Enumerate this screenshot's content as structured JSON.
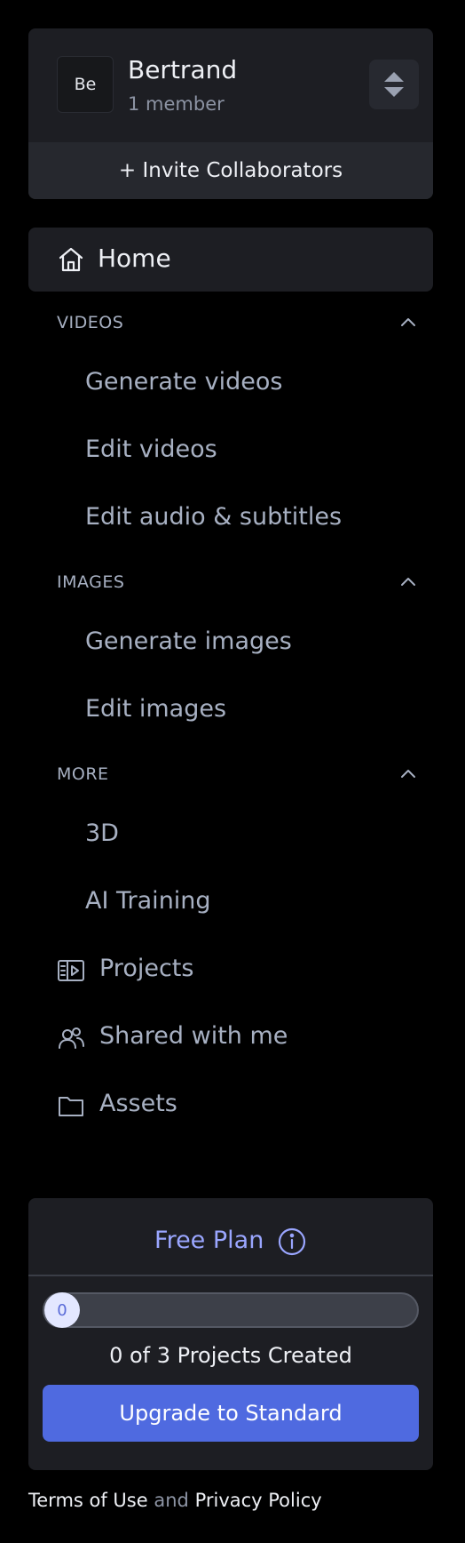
{
  "team": {
    "avatar_initials": "Be",
    "name": "Bertrand",
    "members": "1 member",
    "invite_label": "+ Invite Collaborators"
  },
  "nav": {
    "home_label": "Home",
    "sections": [
      {
        "title": "VIDEOS",
        "expanded": true,
        "items": [
          "Generate videos",
          "Edit videos",
          "Edit audio & subtitles"
        ]
      },
      {
        "title": "IMAGES",
        "expanded": true,
        "items": [
          "Generate images",
          "Edit images"
        ]
      },
      {
        "title": "MORE",
        "expanded": true,
        "items": [
          "3D",
          "AI Training"
        ]
      }
    ],
    "bottom_items": [
      {
        "label": "Projects",
        "icon": "projects-icon"
      },
      {
        "label": "Shared with me",
        "icon": "shared-users-icon"
      },
      {
        "label": "Assets",
        "icon": "folder-icon"
      }
    ]
  },
  "plan": {
    "title": "Free Plan",
    "progress_value": "0",
    "progress_fraction": 0,
    "count_text": "0 of 3 Projects Created",
    "upgrade_label": "Upgrade to Standard"
  },
  "footer": {
    "terms": "Terms of Use",
    "and": "and",
    "privacy": "Privacy Policy"
  },
  "colors": {
    "background": "#000000",
    "card": "#1d1e23",
    "accent": "#4f6ae0",
    "plan_title": "#9aa6ff",
    "muted_text": "#a7b0c2"
  }
}
